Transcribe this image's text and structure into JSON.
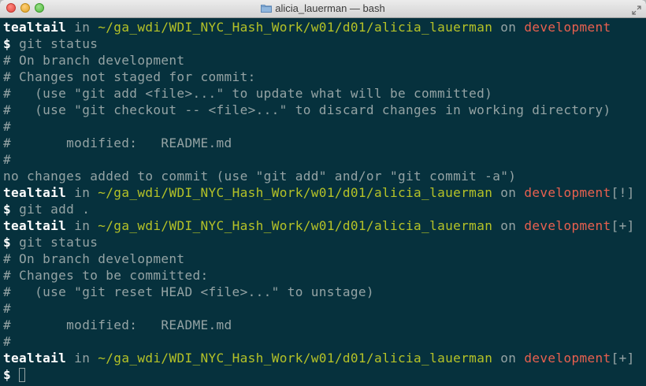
{
  "window": {
    "title": "alicia_lauerman — bash",
    "folder_icon": "folder-icon",
    "fullscreen_icon": "fullscreen-arrows-icon"
  },
  "prompt_parts": {
    "user": "tealtail",
    "in": "in",
    "path": "~/ga_wdi/WDI_NYC_Hash_Work/w01/d01/alicia_lauerman",
    "on": "on",
    "branch": "development",
    "dollar": "$"
  },
  "lines": [
    {
      "type": "prompt",
      "status": ""
    },
    {
      "type": "command",
      "text": "git status"
    },
    {
      "type": "output",
      "text": "# On branch development"
    },
    {
      "type": "output",
      "text": "# Changes not staged for commit:"
    },
    {
      "type": "output",
      "text": "#   (use \"git add <file>...\" to update what will be committed)"
    },
    {
      "type": "output",
      "text": "#   (use \"git checkout -- <file>...\" to discard changes in working directory)"
    },
    {
      "type": "output",
      "text": "#"
    },
    {
      "type": "output",
      "text": "#       modified:   README.md"
    },
    {
      "type": "output",
      "text": "#"
    },
    {
      "type": "output",
      "text": "no changes added to commit (use \"git add\" and/or \"git commit -a\")"
    },
    {
      "type": "prompt",
      "status": "[!]"
    },
    {
      "type": "command",
      "text": "git add ."
    },
    {
      "type": "prompt",
      "status": "[+]"
    },
    {
      "type": "command",
      "text": "git status"
    },
    {
      "type": "output",
      "text": "# On branch development"
    },
    {
      "type": "output",
      "text": "# Changes to be committed:"
    },
    {
      "type": "output",
      "text": "#   (use \"git reset HEAD <file>...\" to unstage)"
    },
    {
      "type": "output",
      "text": "#"
    },
    {
      "type": "output",
      "text": "#       modified:   README.md"
    },
    {
      "type": "output",
      "text": "#"
    },
    {
      "type": "prompt",
      "status": "[+]"
    },
    {
      "type": "input",
      "text": ""
    }
  ],
  "colors": {
    "background": "#06313d",
    "path": "#b5c227",
    "branch": "#e8604f",
    "text": "#94a3a4",
    "user": "#ffffff"
  }
}
